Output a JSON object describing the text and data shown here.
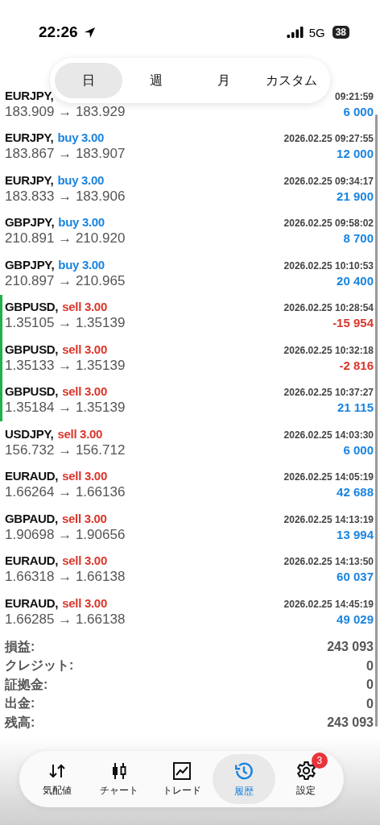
{
  "status_bar": {
    "time": "22:26",
    "network": "5G",
    "battery": "38"
  },
  "period_tabs": [
    {
      "label": "日",
      "selected": true
    },
    {
      "label": "週",
      "selected": false
    },
    {
      "label": "月",
      "selected": false
    },
    {
      "label": "カスタム",
      "selected": false
    }
  ],
  "trades": [
    {
      "symbol": "EURJPY,",
      "time": "09:21:59",
      "prices": "183.909 → 183.929",
      "profit": "6 000",
      "loss": false,
      "marked": false
    },
    {
      "symbol": "EURJPY,",
      "side": "buy 3.00",
      "kind": "buy",
      "time": "2026.02.25 09:27:55",
      "prices": "183.867 → 183.907",
      "profit": "12 000",
      "loss": false,
      "marked": false
    },
    {
      "symbol": "EURJPY,",
      "side": "buy 3.00",
      "kind": "buy",
      "time": "2026.02.25 09:34:17",
      "prices": "183.833 → 183.906",
      "profit": "21 900",
      "loss": false,
      "marked": false
    },
    {
      "symbol": "GBPJPY,",
      "side": "buy 3.00",
      "kind": "buy",
      "time": "2026.02.25 09:58:02",
      "prices": "210.891 → 210.920",
      "profit": "8 700",
      "loss": false,
      "marked": false
    },
    {
      "symbol": "GBPJPY,",
      "side": "buy 3.00",
      "kind": "buy",
      "time": "2026.02.25 10:10:53",
      "prices": "210.897 → 210.965",
      "profit": "20 400",
      "loss": false,
      "marked": false
    },
    {
      "symbol": "GBPUSD,",
      "side": "sell 3.00",
      "kind": "sell",
      "time": "2026.02.25 10:28:54",
      "prices": "1.35105 → 1.35139",
      "profit": "-15 954",
      "loss": true,
      "marked": true
    },
    {
      "symbol": "GBPUSD,",
      "side": "sell 3.00",
      "kind": "sell",
      "time": "2026.02.25 10:32:18",
      "prices": "1.35133 → 1.35139",
      "profit": "-2 816",
      "loss": true,
      "marked": true
    },
    {
      "symbol": "GBPUSD,",
      "side": "sell 3.00",
      "kind": "sell",
      "time": "2026.02.25 10:37:27",
      "prices": "1.35184 → 1.35139",
      "profit": "21 115",
      "loss": false,
      "marked": true
    },
    {
      "symbol": "USDJPY,",
      "side": "sell 3.00",
      "kind": "sell",
      "time": "2026.02.25 14:03:30",
      "prices": "156.732 → 156.712",
      "profit": "6 000",
      "loss": false,
      "marked": false
    },
    {
      "symbol": "EURAUD,",
      "side": "sell 3.00",
      "kind": "sell",
      "time": "2026.02.25 14:05:19",
      "prices": "1.66264 → 1.66136",
      "profit": "42 688",
      "loss": false,
      "marked": false
    },
    {
      "symbol": "GBPAUD,",
      "side": "sell 3.00",
      "kind": "sell",
      "time": "2026.02.25 14:13:19",
      "prices": "1.90698 → 1.90656",
      "profit": "13 994",
      "loss": false,
      "marked": false
    },
    {
      "symbol": "EURAUD,",
      "side": "sell 3.00",
      "kind": "sell",
      "time": "2026.02.25 14:13:50",
      "prices": "1.66318 → 1.66138",
      "profit": "60 037",
      "loss": false,
      "marked": false
    },
    {
      "symbol": "EURAUD,",
      "side": "sell 3.00",
      "kind": "sell",
      "time": "2026.02.25 14:45:19",
      "prices": "1.66285 → 1.66138",
      "profit": "49 029",
      "loss": false,
      "marked": false
    }
  ],
  "summary": [
    {
      "label": "損益:",
      "value": "243 093"
    },
    {
      "label": "クレジット:",
      "value": "0"
    },
    {
      "label": "証拠金:",
      "value": "0"
    },
    {
      "label": "出金:",
      "value": "0"
    },
    {
      "label": "残高:",
      "value": "243 093"
    }
  ],
  "nav": [
    {
      "label": "気配値",
      "kind": "quotes",
      "selected": false
    },
    {
      "label": "チャート",
      "kind": "chart",
      "selected": false
    },
    {
      "label": "トレード",
      "kind": "trade",
      "selected": false
    },
    {
      "label": "履歴",
      "kind": "history",
      "selected": true
    },
    {
      "label": "設定",
      "kind": "settings",
      "selected": false,
      "badge": "3"
    }
  ]
}
